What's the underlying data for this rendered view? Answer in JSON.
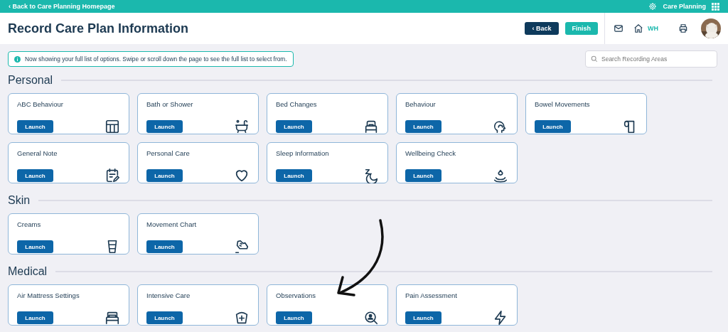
{
  "top_bar": {
    "back_link": "‹ Back to Care Planning Homepage",
    "app_name": "Care Planning"
  },
  "header": {
    "title": "Record Care Plan Information",
    "buttons": [
      {
        "label": "‹ Back",
        "kind": "dark"
      },
      {
        "label": "Finish",
        "kind": "teal"
      }
    ],
    "home_label": "WH"
  },
  "info_banner": "Now showing your full list of options. Swipe or scroll down the page to see the full list to select from.",
  "search": {
    "placeholder": "Search Recording Areas"
  },
  "sections": [
    {
      "title": "Personal",
      "cards": [
        {
          "title": "ABC Behaviour",
          "button": "Launch"
        },
        {
          "title": "Bath or Shower",
          "button": "Launch"
        },
        {
          "title": "Bed Changes",
          "button": "Launch"
        },
        {
          "title": "Behaviour",
          "button": "Launch"
        },
        {
          "title": "Bowel Movements",
          "button": "Launch"
        },
        {
          "title": "General Note",
          "button": "Launch"
        },
        {
          "title": "Personal Care",
          "button": "Launch"
        },
        {
          "title": "Sleep Information",
          "button": "Launch"
        },
        {
          "title": "Wellbeing Check",
          "button": "Launch"
        }
      ]
    },
    {
      "title": "Skin",
      "cards": [
        {
          "title": "Creams",
          "button": "Launch"
        },
        {
          "title": "Movement Chart",
          "button": "Launch"
        }
      ]
    },
    {
      "title": "Medical",
      "cards": [
        {
          "title": "Air Mattress Settings",
          "button": "Launch"
        },
        {
          "title": "Intensive Care",
          "button": "Launch"
        },
        {
          "title": "Observations",
          "button": "Launch"
        },
        {
          "title": "Pain Assessment",
          "button": "Launch"
        }
      ]
    }
  ]
}
